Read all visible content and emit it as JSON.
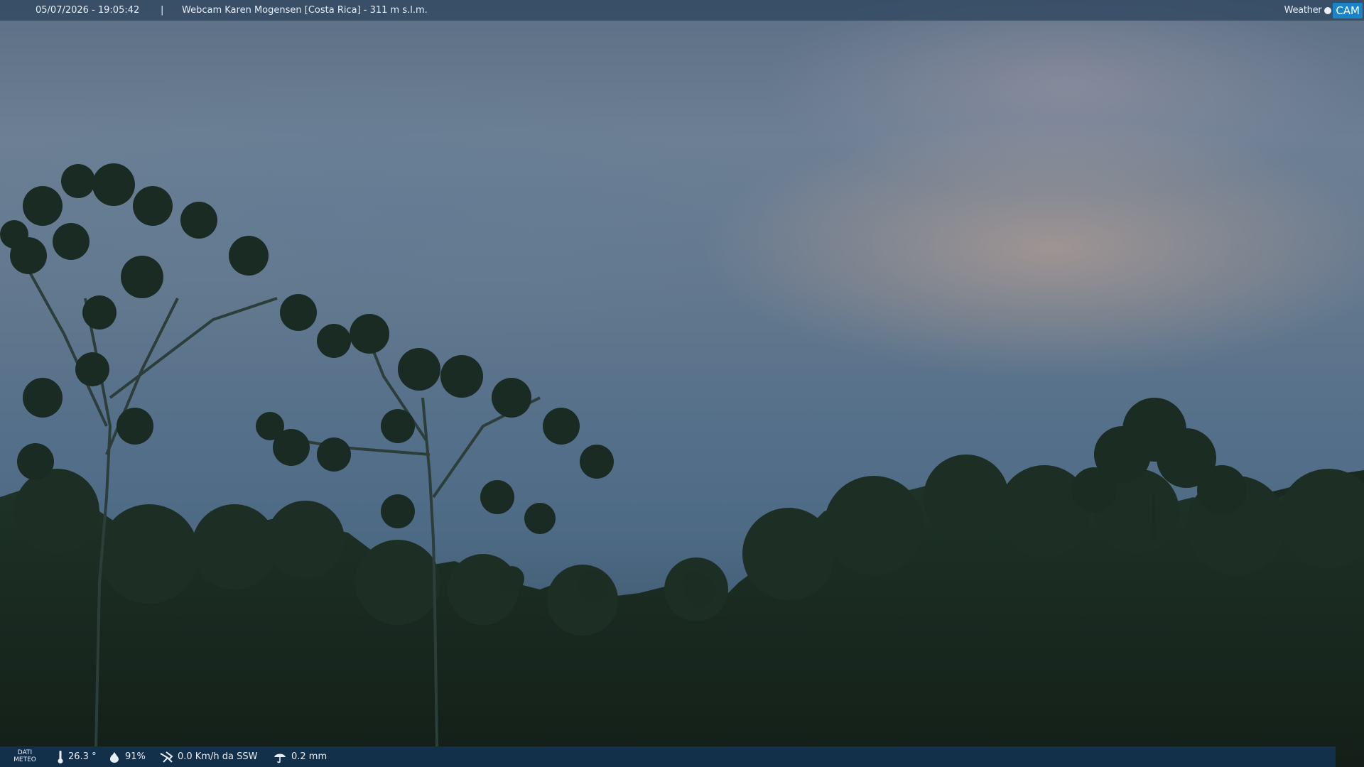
{
  "header": {
    "datetime": "05/07/2026 - 19:05:42",
    "separator": "|",
    "title": "Webcam Karen Mogensen [Costa Rica]  - 311 m s.l.m."
  },
  "logo": {
    "word": "Weather",
    "cam": "CAM"
  },
  "footer": {
    "label_line1": "DATI",
    "label_line2": "METEO",
    "temperature": "26.3 °",
    "humidity": "91%",
    "wind": "0.0 Km/h da SSW",
    "rain": "0.2 mm"
  },
  "icons": {
    "temperature": "thermometer-icon",
    "humidity": "water-drop-icon",
    "wind": "wind-vane-icon",
    "rain": "umbrella-icon"
  },
  "colors": {
    "bar_top": "#30465f",
    "bar_bottom": "#123250",
    "logo_accent": "#1b84c8"
  }
}
